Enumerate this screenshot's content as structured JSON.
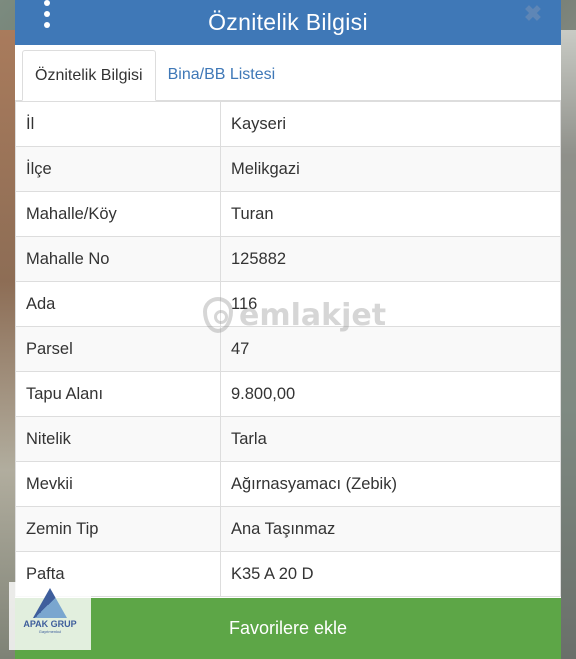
{
  "header": {
    "title": "Öznitelik Bilgisi"
  },
  "tabs": [
    {
      "label": "Öznitelik Bilgisi",
      "active": true
    },
    {
      "label": "Bina/BB Listesi",
      "active": false
    }
  ],
  "attributes": [
    {
      "key": "İl",
      "value": "Kayseri"
    },
    {
      "key": "İlçe",
      "value": "Melikgazi"
    },
    {
      "key": "Mahalle/Köy",
      "value": "Turan"
    },
    {
      "key": "Mahalle No",
      "value": "125882"
    },
    {
      "key": "Ada",
      "value": "116"
    },
    {
      "key": "Parsel",
      "value": "47"
    },
    {
      "key": "Tapu Alanı",
      "value": "9.800,00"
    },
    {
      "key": "Nitelik",
      "value": "Tarla"
    },
    {
      "key": "Mevkii",
      "value": "Ağırnasyamacı (Zebik)"
    },
    {
      "key": "Zemin Tip",
      "value": "Ana Taşınmaz"
    },
    {
      "key": "Pafta",
      "value": "K35 A 20 D"
    }
  ],
  "footer": {
    "favorites_label": "Favorilere ekle"
  },
  "watermark": {
    "text": "emlakjet"
  },
  "logo_badge": {
    "name": "APAK GRUP",
    "sub": "Gayrimenkul"
  },
  "colors": {
    "header": "#3f78b7",
    "footer": "#5da647",
    "tab_link": "#3f78b7"
  },
  "icons": {
    "menu": "vertical-ellipsis-icon",
    "close": "close-icon"
  }
}
